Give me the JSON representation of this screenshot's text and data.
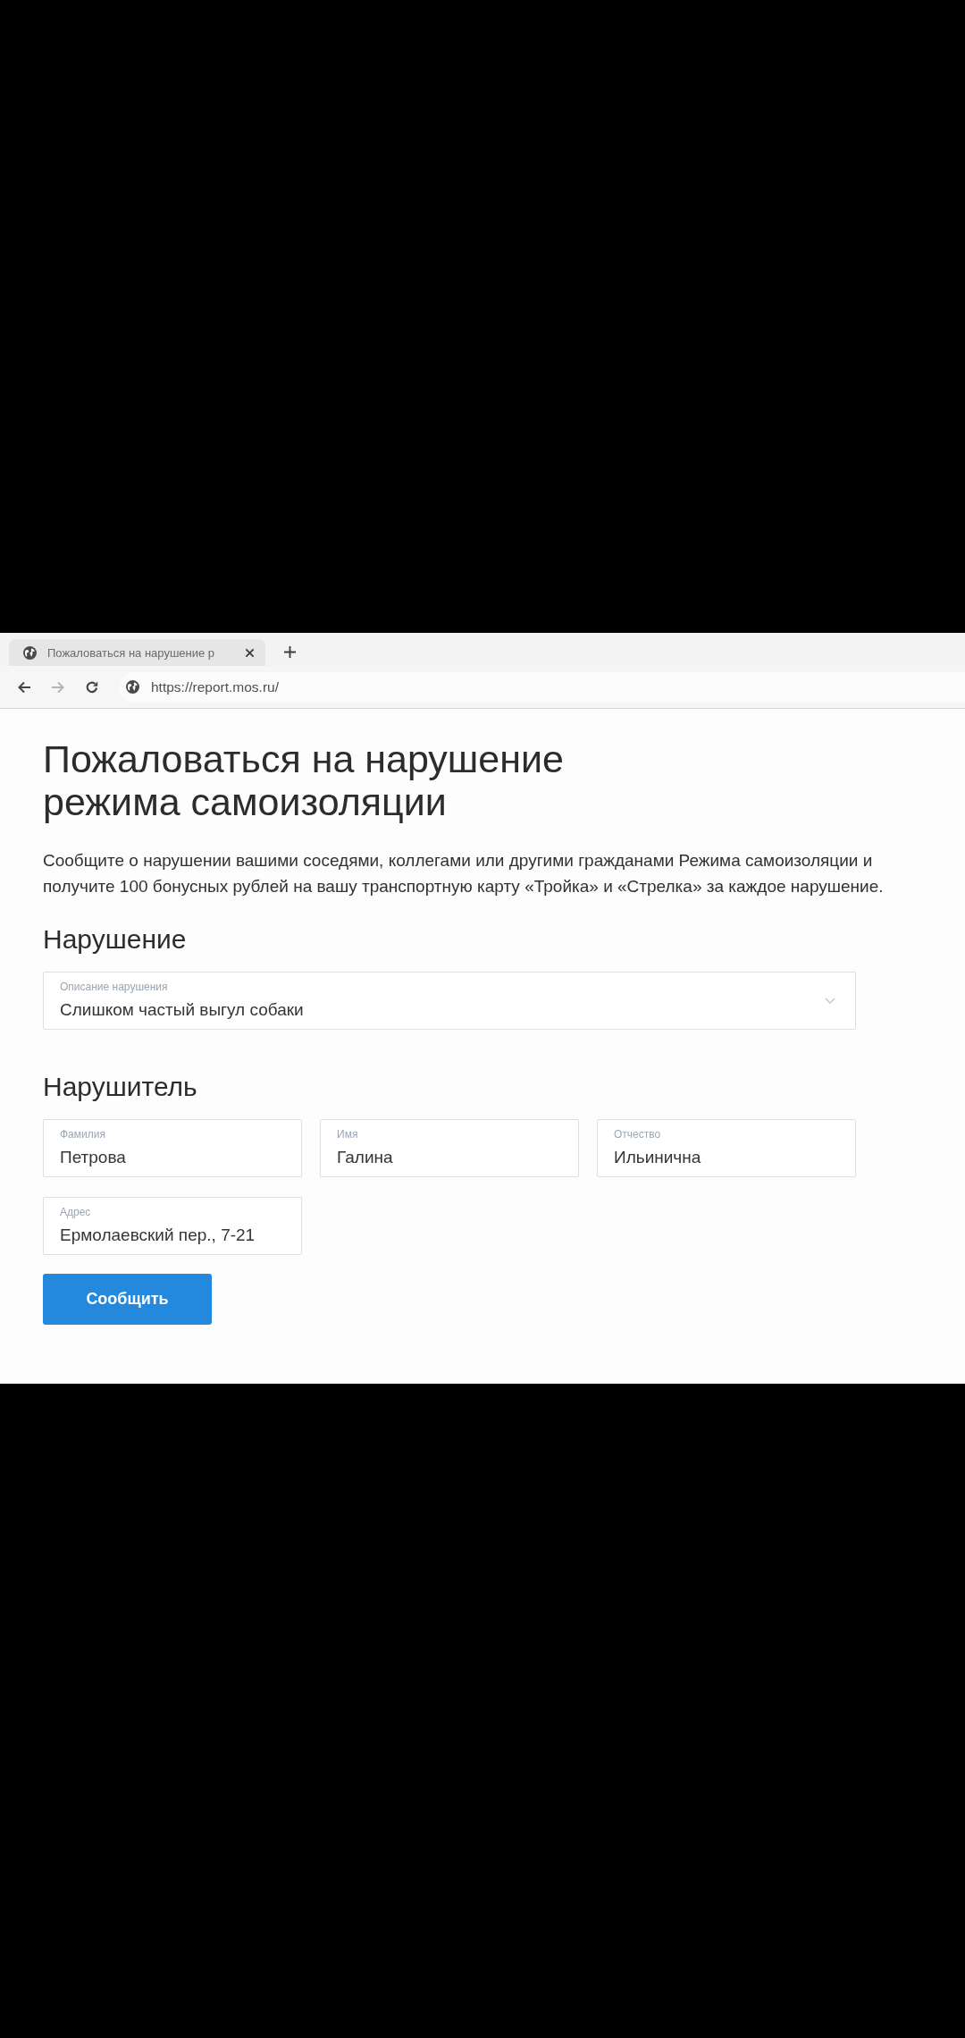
{
  "browser": {
    "tabs": [
      {
        "title": "Пожаловаться на нарушение р",
        "selected": true
      }
    ],
    "nav_buttons": [
      {
        "kind": "back",
        "disabled": false
      },
      {
        "kind": "forward",
        "disabled": true
      },
      {
        "kind": "reload",
        "disabled": false
      }
    ],
    "url": "https://report.mos.ru/"
  },
  "page": {
    "title": "Пожаловаться на нарушение режима самоизоляции",
    "description": "Сообщите о нарушении вашими соседями, коллегами или другими гражданами Режима самоизоляции и получите 100 бонусных рублей на вашу транспортную карту «Тройка» и «Стрелка» за каждое нарушение.",
    "sections": [
      {
        "heading": "Нарушение",
        "fields": [
          {
            "kind": "select",
            "label": "Описание нарушения",
            "value": "Слишком частый выгул собаки"
          }
        ]
      },
      {
        "heading": "Нарушитель",
        "fields": [
          {
            "kind": "text",
            "label": "Фамилия",
            "value": "Петрова"
          },
          {
            "kind": "text",
            "label": "Имя",
            "value": "Галина"
          },
          {
            "kind": "text",
            "label": "Отчество",
            "value": "Ильинична"
          },
          {
            "kind": "text",
            "label": "Адрес",
            "value": "Ермолаевский пер., 7-21"
          }
        ]
      }
    ],
    "submit_button": "Сообщить"
  }
}
